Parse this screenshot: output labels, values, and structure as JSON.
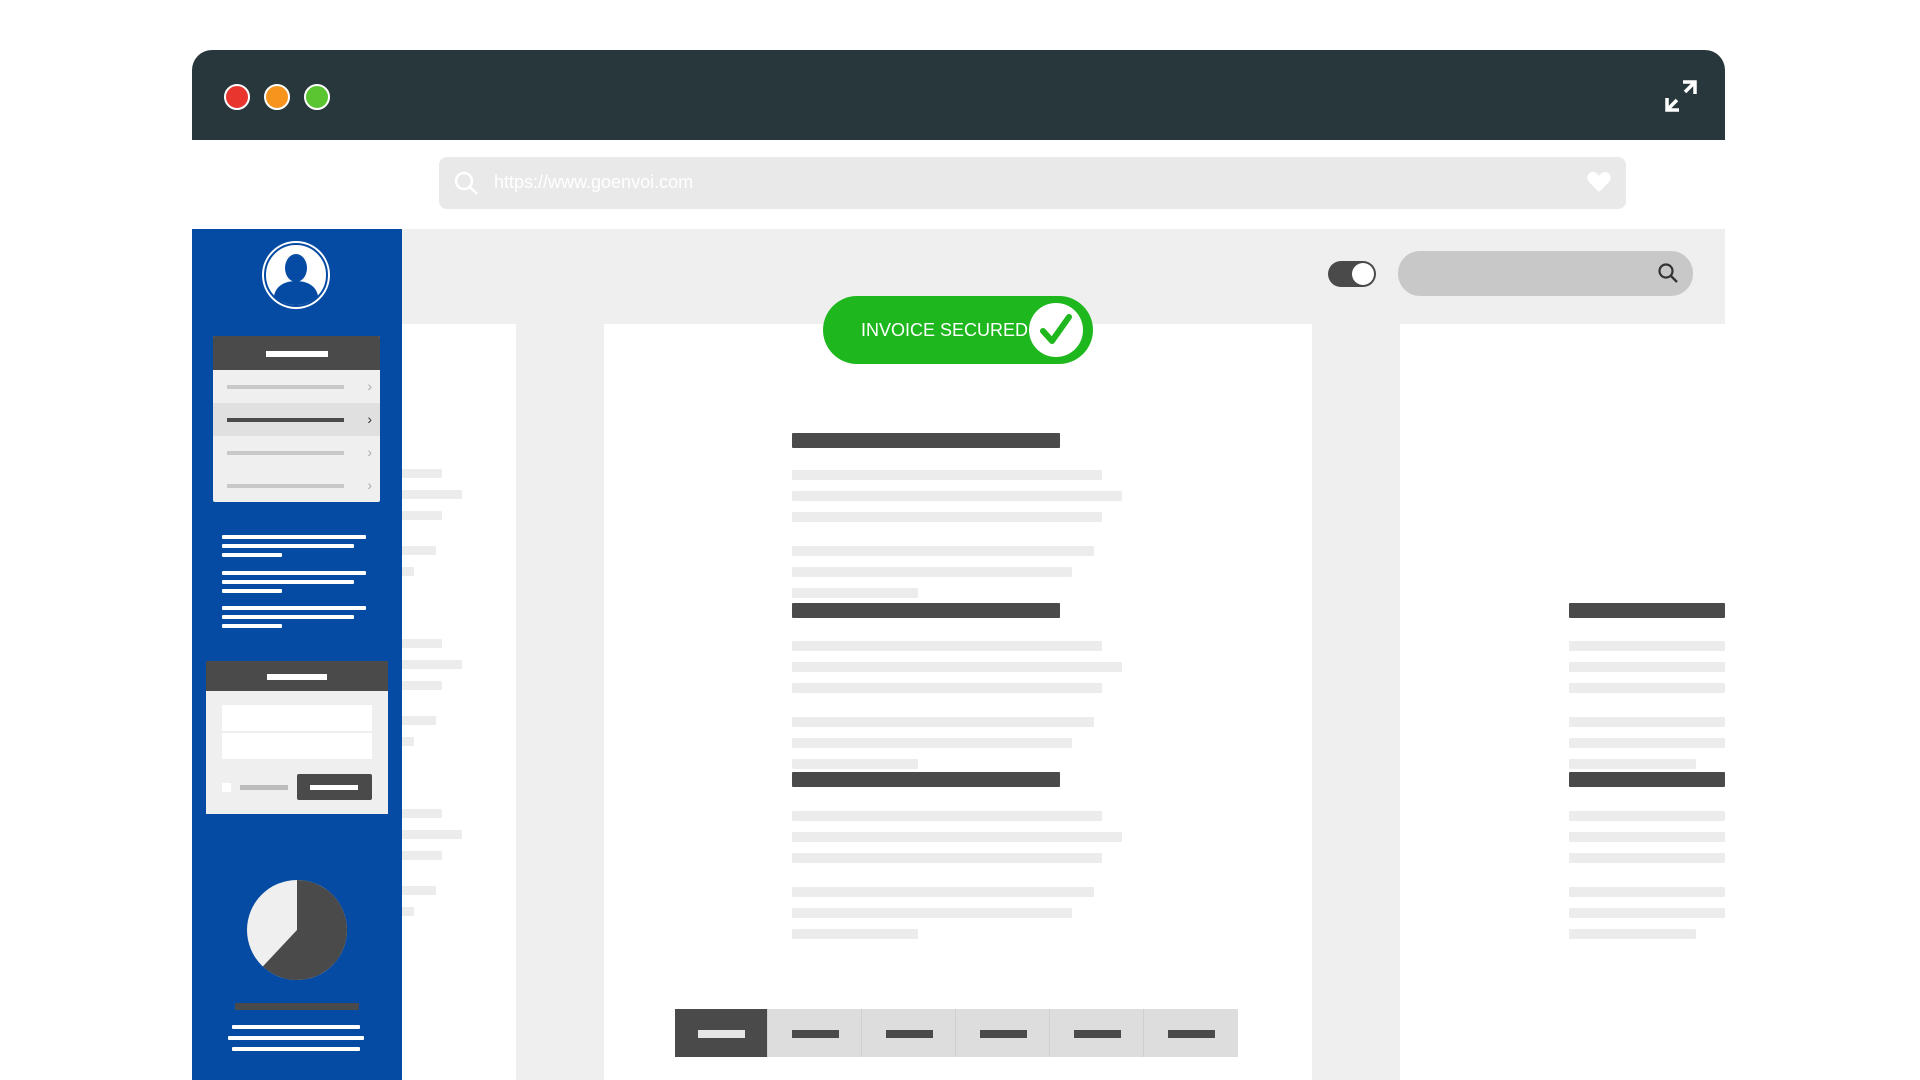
{
  "browser": {
    "url_placeholder": "https://www.goenvoi.com",
    "window_buttons": [
      "close",
      "minimize",
      "maximize"
    ],
    "icons": {
      "expand": "expand-arrows-icon",
      "search": "search-icon",
      "favorite": "heart-icon"
    }
  },
  "badge": {
    "label": "INVOICE SECURED",
    "icon": "checkmark-icon",
    "color": "#1eb81e"
  },
  "toolbar": {
    "toggle_on": true,
    "search_icon": "search-icon"
  },
  "sidebar": {
    "color": "#054aa3",
    "avatar_icon": "user-silhouette-icon",
    "menu_item_count": 4,
    "active_menu_item": 2,
    "pie_fraction_dark": 0.62
  },
  "pager": {
    "page_count": 6,
    "active_page": 1
  }
}
